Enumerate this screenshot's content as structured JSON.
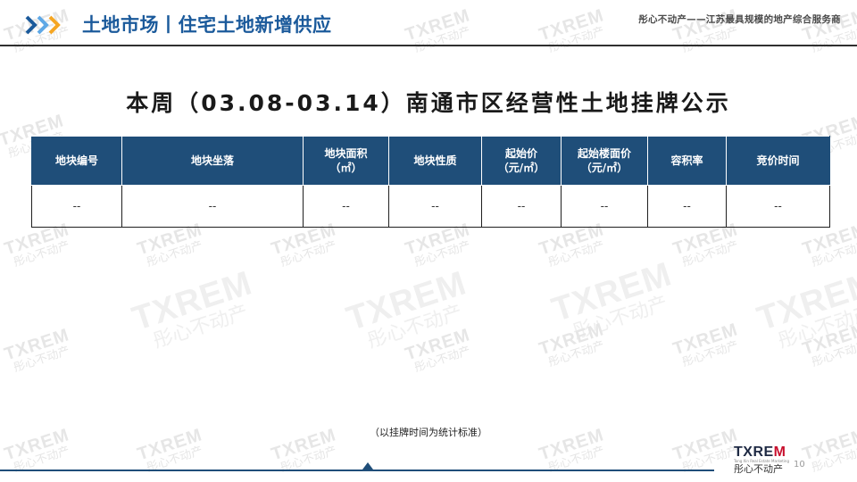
{
  "header": {
    "section_title": "土地市场丨住宅土地新增供应",
    "slogan": "彤心不动产——江苏最具规模的地产综合服务商",
    "accent_colors": [
      "#1b5a9b",
      "#5fa8e6",
      "#f5a623"
    ]
  },
  "main_title": "本周（03.08-03.14）南通市区经营性土地挂牌公示",
  "table": {
    "header_color": "#1f4e79",
    "columns": [
      {
        "line1": "地块编号",
        "line2": ""
      },
      {
        "line1": "地块坐落",
        "line2": ""
      },
      {
        "line1": "地块面积",
        "line2": "（㎡）"
      },
      {
        "line1": "地块性质",
        "line2": ""
      },
      {
        "line1": "起始价",
        "line2": "（元/㎡）"
      },
      {
        "line1": "起始楼面价",
        "line2": "（元/㎡）"
      },
      {
        "line1": "容积率",
        "line2": ""
      },
      {
        "line1": "竞价时间",
        "line2": ""
      }
    ],
    "rows": [
      [
        "--",
        "--",
        "--",
        "--",
        "--",
        "--",
        "--",
        "--"
      ]
    ]
  },
  "footnote": "（以挂牌时间为统计标准）",
  "watermark": {
    "brand": "TXREM",
    "cn": "彤心不动产"
  },
  "logo": {
    "brand_prefix": "TXRE",
    "brand_suffix": "M",
    "tagline": "Tong Xin Real Estate Marketing",
    "cn": "彤心不动产"
  },
  "page_number": "10"
}
